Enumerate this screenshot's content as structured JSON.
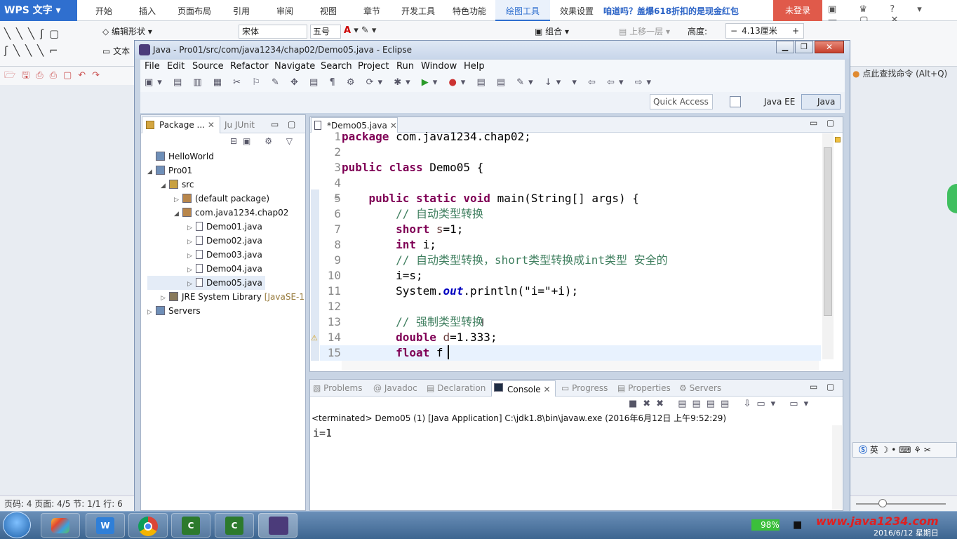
{
  "wps": {
    "app_name": "WPS 文字",
    "tabs": [
      "开始",
      "插入",
      "页面布局",
      "引用",
      "审阅",
      "视图",
      "章节",
      "开发工具",
      "特色功能",
      "绘图工具",
      "效果设置"
    ],
    "active_tab": "绘图工具",
    "promo": "咱道吗？盖爆618折扣的是现金红包",
    "login": "未登录",
    "ribbon": {
      "edit_shape": "编辑形状",
      "text": "文本",
      "font": "宋体",
      "size": "五号",
      "group": "组合",
      "bring_forward": "上移一层",
      "height_label": "高度:",
      "height_value": "4.13厘米"
    },
    "search": "点此查找命令 (Alt+Q)",
    "status": "页码: 4  页面: 4/5  节: 1/1  行: 6",
    "ime": "英"
  },
  "eclipse": {
    "title": "Java - Pro01/src/com/java1234/chap02/Demo05.java - Eclipse",
    "menu": [
      "File",
      "Edit",
      "Source",
      "Refactor",
      "Navigate",
      "Search",
      "Project",
      "Run",
      "Window",
      "Help"
    ],
    "quick_access": "Quick Access",
    "perspectives": {
      "javaee": "Java EE",
      "java": "Java"
    },
    "package_explorer": {
      "tab": "Package ...",
      "junit_tab": "JUnit",
      "tree": [
        {
          "label": "HelloWorld",
          "level": 0,
          "expanded": null,
          "icon": "project"
        },
        {
          "label": "Pro01",
          "level": 0,
          "expanded": true,
          "icon": "project"
        },
        {
          "label": "src",
          "level": 1,
          "expanded": true,
          "icon": "source-folder"
        },
        {
          "label": "(default package)",
          "level": 2,
          "expanded": false,
          "icon": "package"
        },
        {
          "label": "com.java1234.chap02",
          "level": 2,
          "expanded": true,
          "icon": "package"
        },
        {
          "label": "Demo01.java",
          "level": 3,
          "expanded": false,
          "icon": "java-file"
        },
        {
          "label": "Demo02.java",
          "level": 3,
          "expanded": false,
          "icon": "java-file"
        },
        {
          "label": "Demo03.java",
          "level": 3,
          "expanded": false,
          "icon": "java-file"
        },
        {
          "label": "Demo04.java",
          "level": 3,
          "expanded": false,
          "icon": "java-file"
        },
        {
          "label": "Demo05.java",
          "level": 3,
          "expanded": false,
          "icon": "java-file",
          "selected": true
        },
        {
          "label": "JRE System Library",
          "suffix": "[JavaSE-1",
          "level": 1,
          "expanded": false,
          "icon": "library"
        },
        {
          "label": "Servers",
          "level": 0,
          "expanded": false,
          "icon": "project"
        }
      ]
    },
    "editor": {
      "tab": "*Demo05.java",
      "lines": [
        {
          "n": "1",
          "code": "package com.java1234.chap02;"
        },
        {
          "n": "2",
          "code": ""
        },
        {
          "n": "3",
          "code": "public class Demo05 {"
        },
        {
          "n": "4",
          "code": ""
        },
        {
          "n": "5",
          "code": "    public static void main(String[] args) {"
        },
        {
          "n": "6",
          "code": "        // 自动类型转换"
        },
        {
          "n": "7",
          "code": "        short s=1;"
        },
        {
          "n": "8",
          "code": "        int i;"
        },
        {
          "n": "9",
          "code": "        // 自动类型转换，short类型转换成int类型 安全的"
        },
        {
          "n": "10",
          "code": "        i=s;"
        },
        {
          "n": "11",
          "code": "        System.out.println(\"i=\"+i);"
        },
        {
          "n": "12",
          "code": ""
        },
        {
          "n": "13",
          "code": "        // 强制类型转换"
        },
        {
          "n": "14",
          "code": "        double d=1.333;"
        },
        {
          "n": "15",
          "code": "        float f"
        }
      ]
    },
    "console": {
      "tabs": [
        "Problems",
        "Javadoc",
        "Declaration",
        "Console",
        "Progress",
        "Properties",
        "Servers"
      ],
      "active": "Console",
      "terminated": "<terminated> Demo05 (1) [Java Application] C:\\jdk1.8\\bin\\javaw.exe (2016年6月12日 上午9:52:29)",
      "output": "i=1"
    }
  },
  "taskbar": {
    "battery": "98%",
    "watermark": "www.java1234.com",
    "date": "2016/6/12 星期日"
  },
  "colors": {
    "keyword": "#7f0055",
    "comment": "#3f7f5f",
    "field": "#0000c0",
    "wps_blue": "#2f6fcf"
  }
}
